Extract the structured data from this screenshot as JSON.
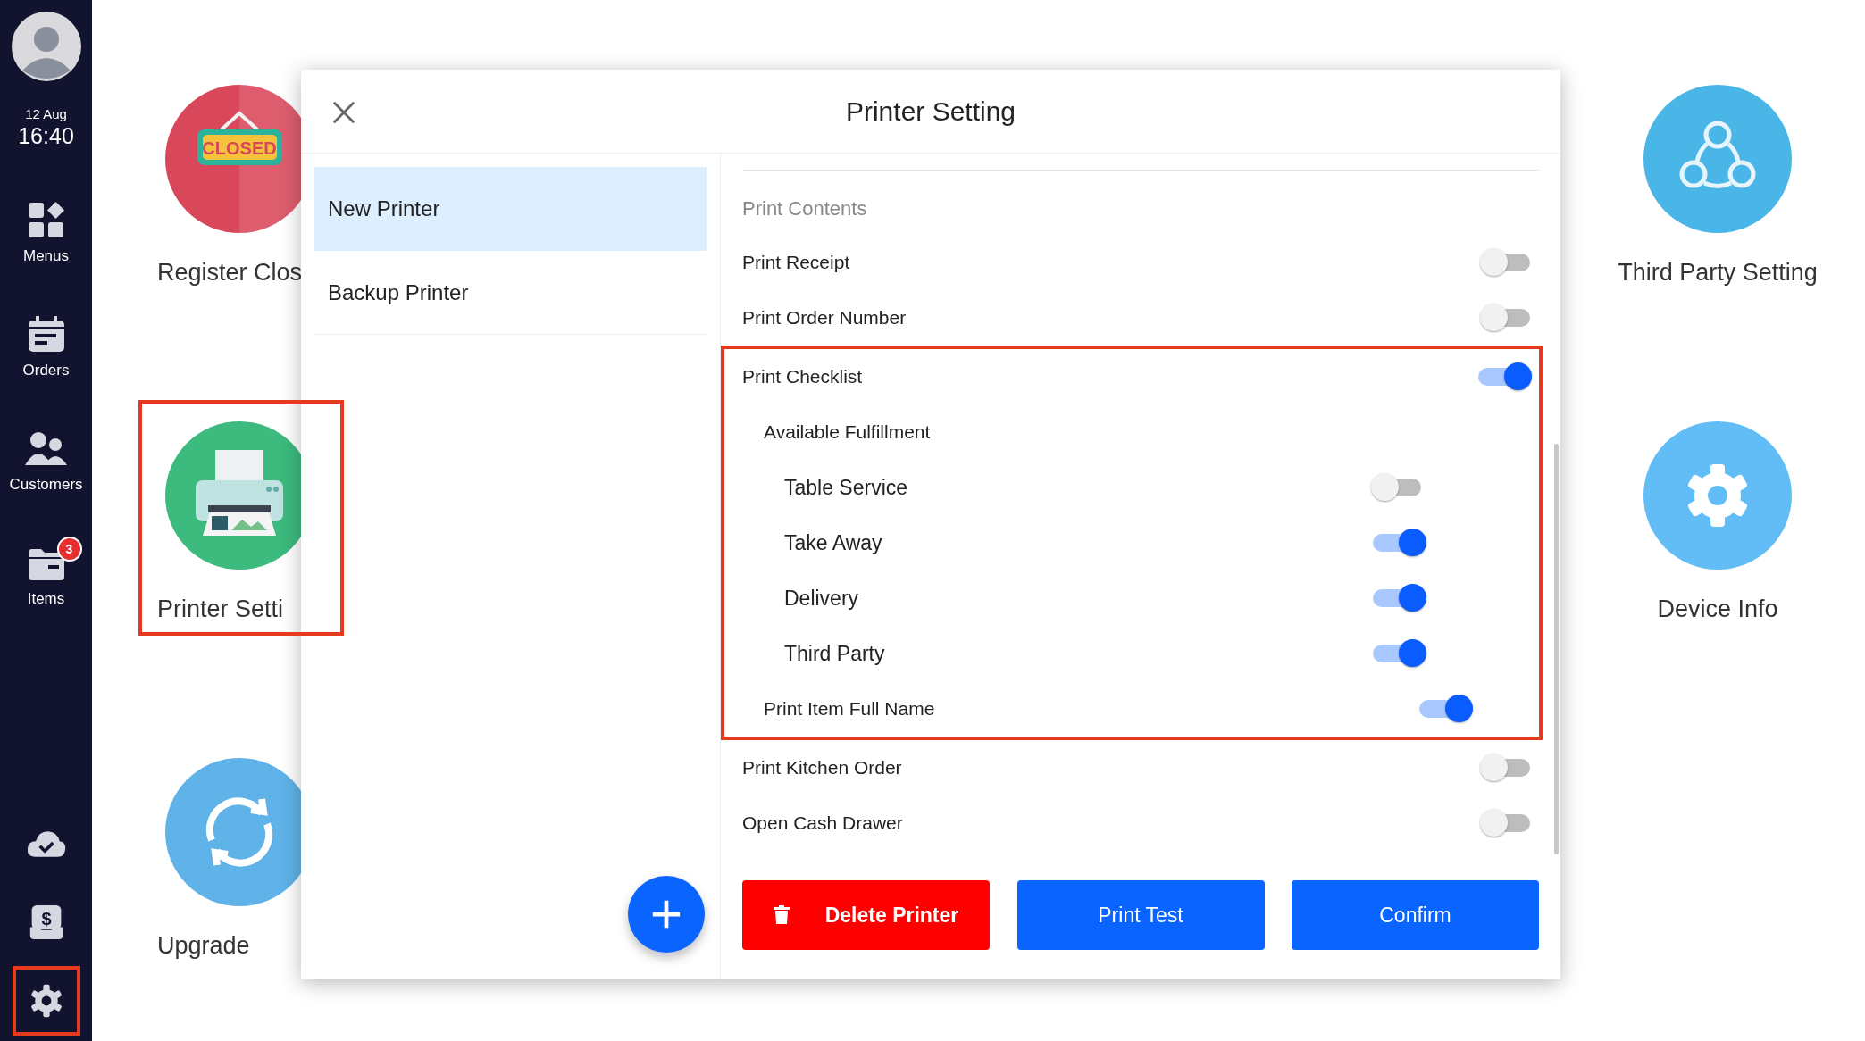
{
  "sidebar": {
    "date": "12 Aug",
    "time": "16:40",
    "nav": [
      {
        "label": "Menus",
        "kind": "grid"
      },
      {
        "label": "Orders",
        "kind": "calendar"
      },
      {
        "label": "Customers",
        "kind": "people"
      },
      {
        "label": "Items",
        "kind": "folder",
        "badge": "3"
      }
    ],
    "bottom": [
      {
        "kind": "cloud",
        "highlighted": false
      },
      {
        "kind": "cash",
        "glyph": "$",
        "highlighted": false
      },
      {
        "kind": "gear",
        "highlighted": true
      }
    ]
  },
  "tiles_left": [
    {
      "label": "Register Clos",
      "kind": "closed-sign",
      "sign": "CLOSED",
      "color": "#d9475a",
      "highlighted": false
    },
    {
      "label": "Printer Setti",
      "kind": "printer",
      "color": "#3dba7e",
      "highlighted": true
    },
    {
      "label": "Upgrade",
      "kind": "sync",
      "color": "#5fb3e8",
      "highlighted": false
    }
  ],
  "tiles_right": [
    {
      "label": "Third Party Setting",
      "kind": "share",
      "color": "#4ab6e8",
      "highlighted": false
    },
    {
      "label": "Device Info",
      "kind": "gear",
      "color": "#62bdf6",
      "highlighted": false
    }
  ],
  "dialog": {
    "title": "Printer Setting",
    "printers": [
      {
        "name": "New Printer",
        "selected": true
      },
      {
        "name": "Backup Printer",
        "selected": false
      }
    ],
    "section": "Print Contents",
    "settings": [
      {
        "label": "Print Receipt",
        "kind": "toggle",
        "on": false
      },
      {
        "label": "Print Order Number",
        "kind": "toggle",
        "on": false
      },
      {
        "label": "Print Checklist",
        "kind": "toggle",
        "on": true,
        "highlighted": true,
        "children": [
          {
            "label": "Available Fulfillment",
            "kind": "heading",
            "children": [
              {
                "label": "Table Service",
                "kind": "toggle",
                "on": false
              },
              {
                "label": "Take Away",
                "kind": "toggle",
                "on": true
              },
              {
                "label": "Delivery",
                "kind": "toggle",
                "on": true
              },
              {
                "label": "Third Party",
                "kind": "toggle",
                "on": true
              }
            ]
          },
          {
            "label": "Print Item Full Name",
            "kind": "toggle",
            "on": true
          }
        ]
      },
      {
        "label": "Print Kitchen Order",
        "kind": "toggle",
        "on": false
      },
      {
        "label": "Open Cash Drawer",
        "kind": "toggle",
        "on": false
      }
    ],
    "buttons": [
      {
        "label": "Delete Printer",
        "kind": "danger"
      },
      {
        "label": "Print Test",
        "kind": "primary"
      },
      {
        "label": "Confirm",
        "kind": "primary"
      }
    ]
  }
}
